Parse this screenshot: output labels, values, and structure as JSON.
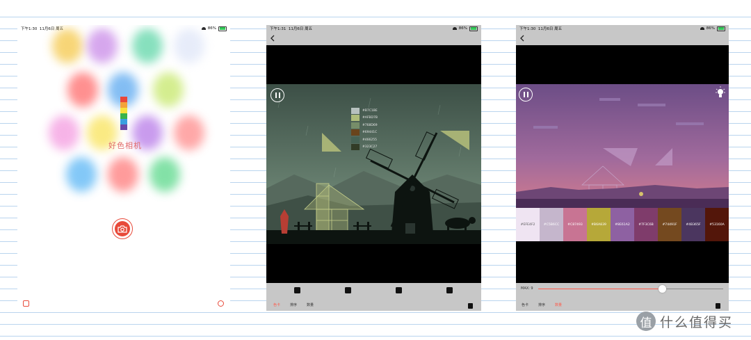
{
  "screen1": {
    "status_time": "下午1:30",
    "status_date": "11月6日 周五",
    "status_battery": "86%",
    "app_name": "好色相机",
    "logo_colors": [
      "#e8473a",
      "#f3a33a",
      "#f7e23d",
      "#3bb34a",
      "#3aa0e0",
      "#6b4aa8"
    ],
    "blob_colors": [
      "#f5c84a",
      "#c98ae8",
      "#5fd6a8",
      "#dfe6f8",
      "#ff6b6b",
      "#5aa8f0",
      "#c6e86a",
      "#f49be0",
      "#f9e35a",
      "#b77ae8",
      "#ff8b8b",
      "#5ab6f5",
      "#ff7a7a",
      "#5ad88a"
    ]
  },
  "screen2": {
    "status_time": "下午1:31",
    "status_date": "11月6日 周五",
    "status_battery": "86%",
    "swatches": [
      {
        "hex": "#B7C1BE",
        "label": "#B7C1BE"
      },
      {
        "hex": "#AFBD7B",
        "label": "#AFBD7B"
      },
      {
        "hex": "#768D69",
        "label": "#768D69"
      },
      {
        "hex": "#69441C",
        "label": "#69441C"
      },
      {
        "hex": "#466255",
        "label": "#466255"
      },
      {
        "hex": "#323C27",
        "label": "#323C27"
      }
    ],
    "tabs": [
      "色卡",
      "排序",
      "数量"
    ],
    "active_tab": 0
  },
  "screen3": {
    "status_time": "下午1:30",
    "status_date": "11月6日 周五",
    "status_battery": "86%",
    "palette": [
      {
        "hex": "#EFE4F2",
        "label": "#EFE4F2",
        "text": "#555555"
      },
      {
        "hex": "#C5B6CC",
        "label": "#C5B6CC",
        "text": "#ffffff"
      },
      {
        "hex": "#C87493",
        "label": "#C87493",
        "text": "#ffffff"
      },
      {
        "hex": "#B6A839",
        "label": "#B6A839",
        "text": "#ffffff"
      },
      {
        "hex": "#8E61A2",
        "label": "#8E61A2",
        "text": "#ffffff"
      },
      {
        "hex": "#7F3C6B",
        "label": "#7F3C6B",
        "text": "#ffffff"
      },
      {
        "hex": "#74491F",
        "label": "#74491F",
        "text": "#ffffff"
      },
      {
        "hex": "#4B365F",
        "label": "#4B365F",
        "text": "#ffffff"
      },
      {
        "hex": "#53160A",
        "label": "#53160A",
        "text": "#ffffff"
      }
    ],
    "max_label": "MAX: 9",
    "slider_fraction": 0.67,
    "tabs": [
      "色卡",
      "排序",
      "数量"
    ],
    "active_tab": 2
  },
  "watermark": {
    "text": "什么值得买",
    "glyph": "值"
  },
  "accent": "#ff5a4a"
}
